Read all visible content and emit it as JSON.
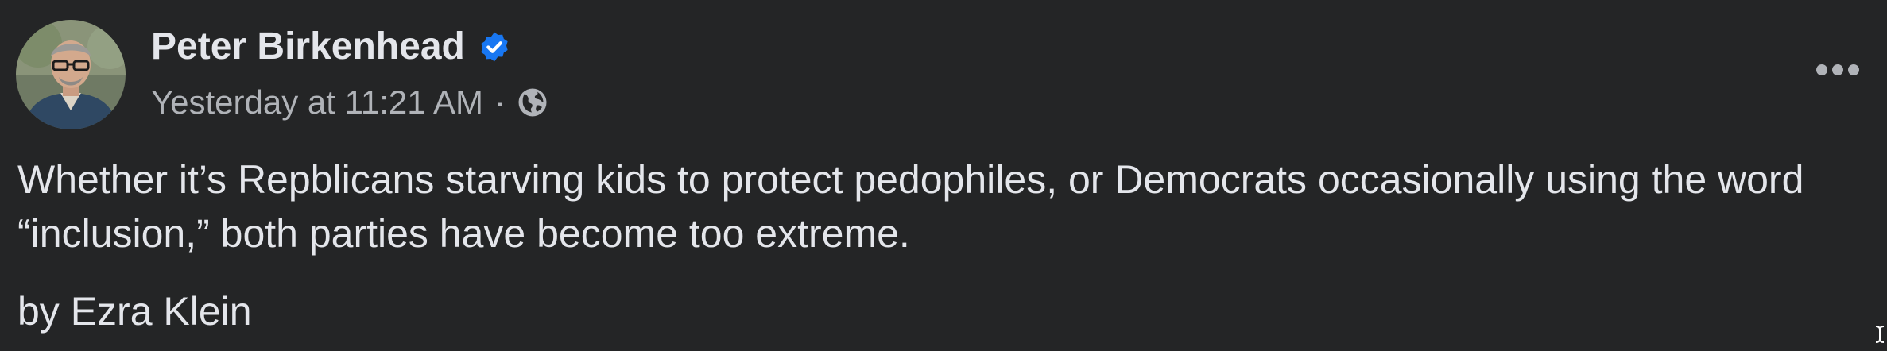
{
  "post": {
    "author": {
      "name": "Peter Birkenhead",
      "verified": true,
      "avatar_alt": "Peter Birkenhead"
    },
    "timestamp": "Yesterday at 11:21 AM",
    "separator": "·",
    "audience_icon": "globe-icon",
    "more_icon": "more-options-icon",
    "paragraphs": [
      "Whether it’s Repblicans starving kids to protect pedophiles, or Democrats occasionally using the word “inclusion,” both parties have become too extreme.",
      "by Ezra Klein"
    ]
  },
  "colors": {
    "background": "#242526",
    "primary_text": "#e4e6eb",
    "secondary_text": "#b0b3b8",
    "verified_badge": "#1877f2"
  }
}
